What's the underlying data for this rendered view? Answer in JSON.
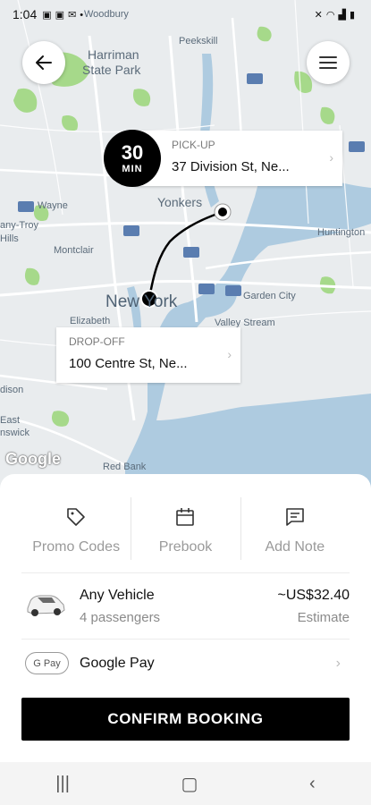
{
  "status_bar": {
    "time": "1:04",
    "left_icons": [
      "image-icon",
      "image-icon",
      "mail-icon",
      "dot-icon"
    ],
    "right_icons": [
      "mute-icon",
      "wifi-icon",
      "signal-icon",
      "battery-icon"
    ]
  },
  "map": {
    "labels": {
      "woodbury": "Woodbury",
      "harriman": "Harriman",
      "state_park": "State Park",
      "peekskill": "Peekskill",
      "wayne": "Wayne",
      "troy": "any-Troy",
      "hills": "Hills",
      "montclair": "Montclair",
      "yonkers": "Yonkers",
      "new_york": "New York",
      "huntington": "Huntington",
      "garden_city": "Garden City",
      "valley_stream": "Valley Stream",
      "elizabeth": "Elizabeth",
      "dison": "dison",
      "east": "East",
      "nswick": "nswick",
      "red_bank": "Red Bank",
      "google": "Google"
    }
  },
  "trip": {
    "eta_value": "30",
    "eta_unit": "MIN",
    "pickup_label": "PICK-UP",
    "pickup_address": "37 Division St, Ne...",
    "dropoff_label": "DROP-OFF",
    "dropoff_address": "100 Centre St, Ne..."
  },
  "actions": [
    {
      "label": "Promo Codes",
      "icon": "tag-icon"
    },
    {
      "label": "Prebook",
      "icon": "calendar-icon"
    },
    {
      "label": "Add Note",
      "icon": "note-icon"
    }
  ],
  "vehicle": {
    "name": "Any Vehicle",
    "passengers": "4 passengers",
    "price": "~US$32.40",
    "price_note": "Estimate"
  },
  "payment": {
    "badge": "G Pay",
    "method": "Google Pay"
  },
  "confirm_label": "CONFIRM BOOKING",
  "colors": {
    "map_land": "#e9ecee",
    "map_water": "#aecbe0",
    "map_park": "#a6d98a",
    "primary_button": "#000000"
  }
}
